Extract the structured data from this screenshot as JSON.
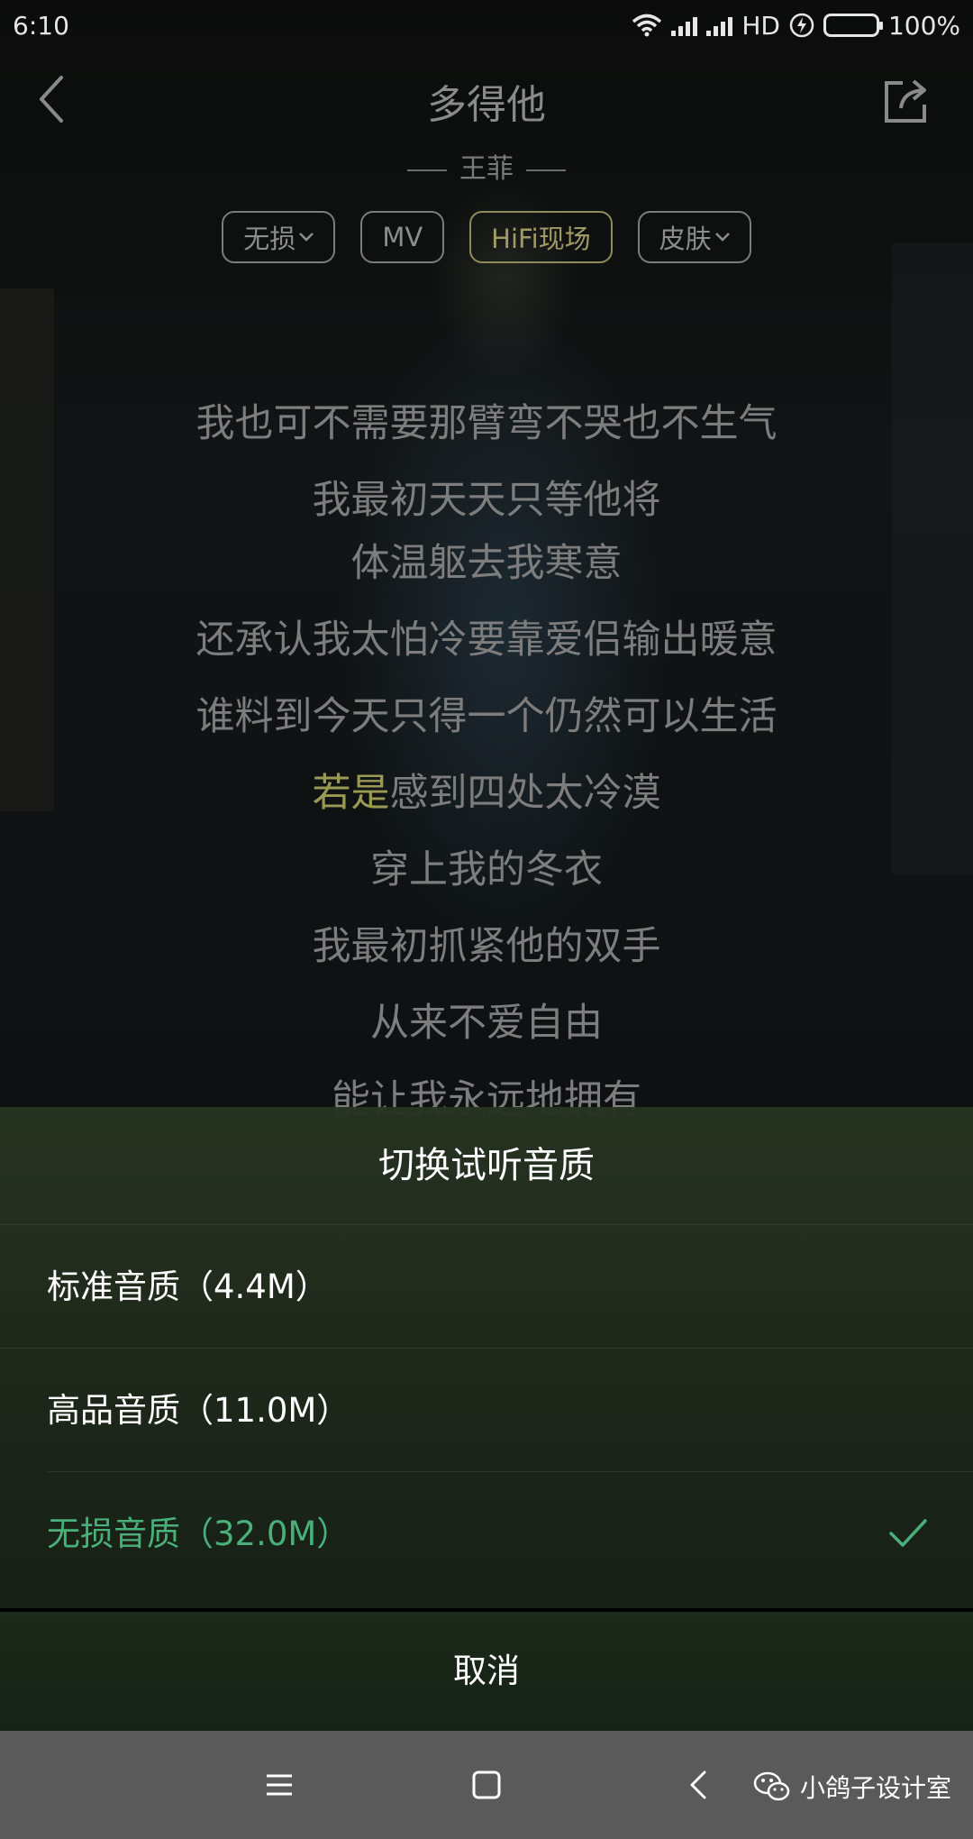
{
  "status_bar": {
    "time": "6:10",
    "network": "HD",
    "battery": "100%"
  },
  "header": {
    "title": "多得他",
    "artist": "王菲"
  },
  "chips": [
    {
      "label": "无损"
    },
    {
      "label": "MV"
    },
    {
      "label": "HiFi现场"
    },
    {
      "label": "皮肤"
    }
  ],
  "lyrics": {
    "lines": [
      "我也可不需要那臂弯不哭也不生气",
      "我最初天天只等他将",
      "体温躯去我寒意",
      "还承认我太怕冷要靠爱侣输出暖意",
      "谁料到今天只得一个仍然可以生活"
    ],
    "current_sung": "若是",
    "current_rest": "感到四处太冷漠",
    "after": [
      "穿上我的冬衣",
      "我最初抓紧他的双手",
      "从来不爱自由",
      "能让我永远地拥有"
    ]
  },
  "sheet": {
    "title": "切换试听音质",
    "options": [
      {
        "label": "标准音质（4.4M）",
        "selected": false
      },
      {
        "label": "高品音质（11.0M）",
        "selected": false
      },
      {
        "label": "无损音质（32.0M）",
        "selected": true
      }
    ],
    "cancel": "取消"
  },
  "watermark": {
    "text": "小鸽子设计室"
  },
  "colors": {
    "accent": "#4ab07a",
    "highlight_lyric": "#9a9a55",
    "battery": "#5fd32d"
  }
}
